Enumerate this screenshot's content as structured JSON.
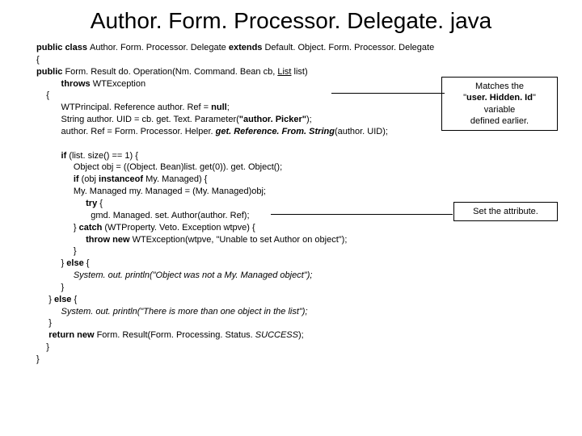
{
  "title": "Author. Form. Processor. Delegate. java",
  "code": {
    "l1a": "public class ",
    "l1b": "Author. Form. Processor. Delegate ",
    "l1c": "extends ",
    "l1d": "Default. Object. Form. Processor. Delegate",
    "l2": "{",
    "l3a": "public ",
    "l3b": "Form. Result do. Operation(Nm. Command. Bean cb, ",
    "l3c": "List",
    "l3d": " list)",
    "l4a": "          throws ",
    "l4b": "WTException",
    "l5": "    {",
    "l6a": "          WTPrincipal. Reference author. Ref = ",
    "l6b": "null",
    "l6c": ";",
    "l7a": "          String author. UID = cb. get. Text. Parameter(",
    "l7b": "\"author. Picker\"",
    "l7c": ");",
    "l8a": "          author. Ref = Form. Processor. Helper. ",
    "l8b": "get. Reference. From. String",
    "l8c": "(author. UID);",
    "blank1": "",
    "l9a": "          if ",
    "l9b": "(list. size() == 1) {",
    "l10": "               Object obj = ((Object. Bean)list. get(0)). get. Object();",
    "l11a": "               if ",
    "l11b": "(obj ",
    "l11c": "instanceof ",
    "l11d": "My. Managed) {",
    "l12": "               My. Managed my. Managed = (My. Managed)obj;",
    "l13a": "                    try ",
    "l13b": "{",
    "l14": "                      gmd. Managed. set. Author(author. Ref);",
    "l15a": "               } ",
    "l15b": "catch ",
    "l15c": "(WTProperty. Veto. Exception wtpve) {",
    "l16a": "                    throw new ",
    "l16b": "WTException(wtpve, \"Unable to set Author on object\");",
    "l17": "               }",
    "l18a": "          } ",
    "l18b": "else ",
    "l18c": "{",
    "l19": "               System. out. println(\"Object was not a My. Managed object\");",
    "l20": "          }",
    "l21a": "     } ",
    "l21b": "else ",
    "l21c": "{",
    "l22": "          System. out. println(\"There is more than one object in the list\");",
    "l23": "     }",
    "l24a": "     return new ",
    "l24b": "Form. Result(Form. Processing. Status. ",
    "l24c": "SUCCESS",
    "l24d": ");",
    "l25": "    }",
    "l26": "}"
  },
  "callout1": {
    "line1": "Matches the",
    "line2a": "\"",
    "line2b": "user. Hidden. Id",
    "line2c": "\" variable",
    "line3": "defined earlier."
  },
  "callout2": "Set the attribute."
}
